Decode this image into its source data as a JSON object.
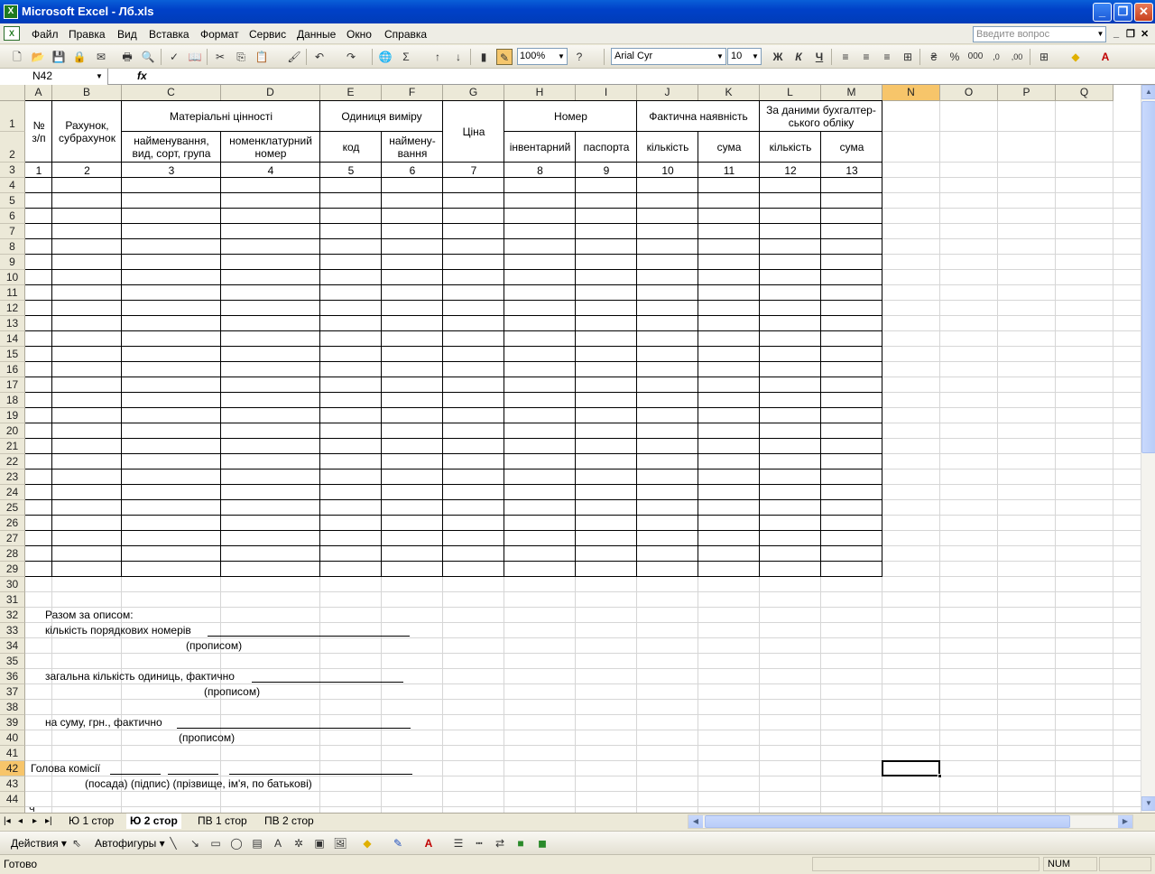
{
  "window": {
    "title": "Microsoft Excel - Лб.xls",
    "app_icon": "excel-icon"
  },
  "menu": {
    "items": [
      "Файл",
      "Правка",
      "Вид",
      "Вставка",
      "Формат",
      "Сервис",
      "Данные",
      "Окно",
      "Справка"
    ],
    "ask_placeholder": "Введите вопрос"
  },
  "toolbar": {
    "zoom": "100%",
    "font": "Arial Cyr",
    "font_size": "10"
  },
  "formula_bar": {
    "name_box": "N42",
    "fx": "fx",
    "formula": ""
  },
  "columns": [
    "A",
    "B",
    "C",
    "D",
    "E",
    "F",
    "G",
    "H",
    "I",
    "J",
    "K",
    "L",
    "M",
    "N",
    "O",
    "P",
    "Q"
  ],
  "rows": [
    "1",
    "2",
    "3",
    "4",
    "5",
    "6",
    "7",
    "8",
    "9",
    "10",
    "11",
    "12",
    "13",
    "14",
    "15",
    "16",
    "17",
    "18",
    "19",
    "20",
    "21",
    "22",
    "23",
    "24",
    "25",
    "26",
    "27",
    "28",
    "29",
    "30",
    "31",
    "32",
    "33",
    "34",
    "35",
    "36",
    "37",
    "38",
    "39",
    "40",
    "41",
    "42",
    "43",
    "44"
  ],
  "sheet": {
    "h_num": "№\nз/п",
    "h_account": "Рахунок,\nсубрахунок",
    "h_material": "Матеріальні цінності",
    "h_name": "найменування,\nвид, сорт, група",
    "h_nomenclature": "номенклатурний\nномер",
    "h_unit": "Одиниця виміру",
    "h_code": "код",
    "h_unitname": "наймену-\nвання",
    "h_price": "Ціна",
    "h_number": "Номер",
    "h_inventory": "інвентарний",
    "h_passport": "паспорта",
    "h_actual": "Фактична наявність",
    "h_qty1": "кількість",
    "h_sum1": "сума",
    "h_accounting": "За даними бухгалтер-\nського обліку",
    "h_qty2": "кількість",
    "h_sum2": "сума",
    "col_numbers": [
      "1",
      "2",
      "3",
      "4",
      "5",
      "6",
      "7",
      "8",
      "9",
      "10",
      "11",
      "12",
      "13"
    ],
    "t_total": "Разом за описом:",
    "t_count": "кількість порядкових номерів",
    "t_inwords": "(прописом)",
    "t_total_units": "загальна кількість одиниць, фактично",
    "t_sum": "на суму, грн., фактично",
    "t_head": "Голова комісії",
    "t_sign": "(посада)  (підпис)   (прізвище, ім'я, по батькові)",
    "t_row45_partial": "Ч"
  },
  "sheet_tabs": [
    {
      "label": "Ю 1 стор",
      "active": false
    },
    {
      "label": "Ю 2 стор",
      "active": true
    },
    {
      "label": "ПВ 1 стор",
      "active": false
    },
    {
      "label": "ПВ 2 стор",
      "active": false
    }
  ],
  "draw_toolbar": {
    "actions": "Действия",
    "autoshapes": "Автофигуры"
  },
  "status": {
    "text": "Готово",
    "num": "NUM"
  },
  "active_cell": "N42"
}
